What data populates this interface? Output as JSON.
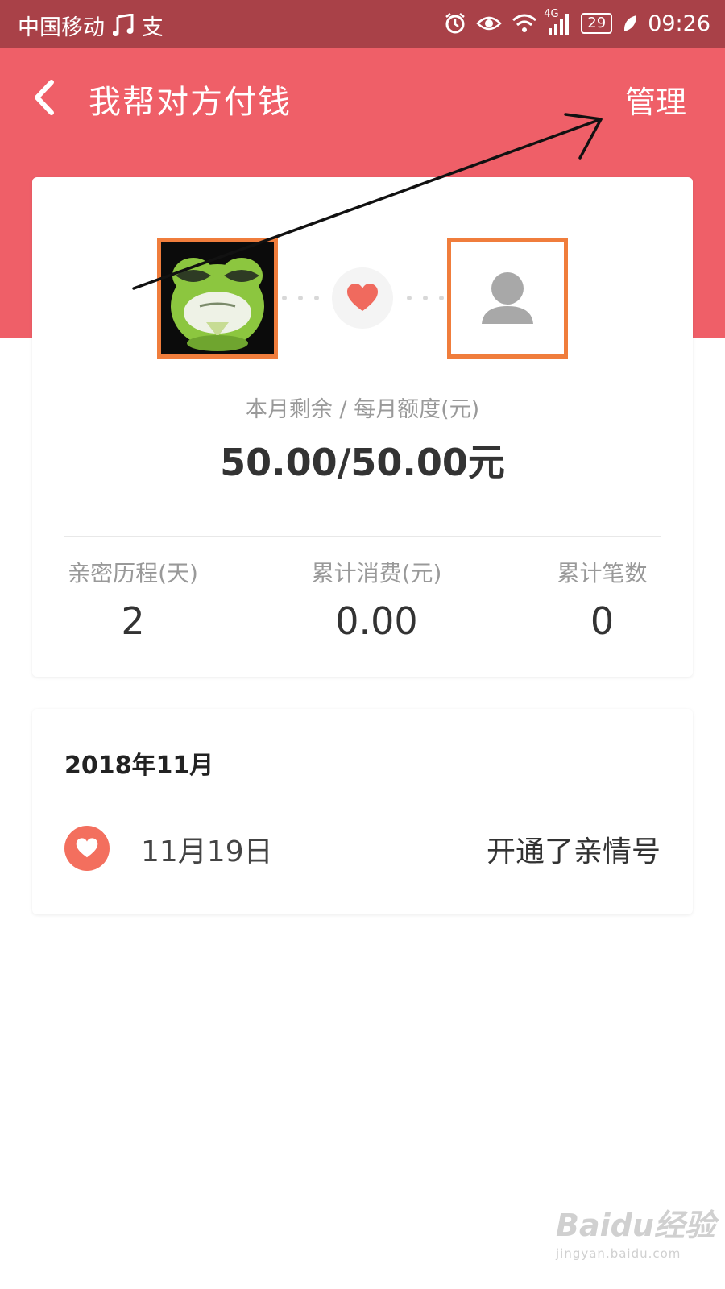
{
  "status_bar": {
    "carrier": "中国移动",
    "alipay_glyph": "支",
    "network_type": "4G",
    "battery": "29",
    "time": "09:26",
    "icons": [
      "music-icon",
      "alipay-icon",
      "alarm-icon",
      "eye-icon",
      "wifi-icon",
      "signal-icon",
      "battery-icon",
      "leaf-icon"
    ]
  },
  "header": {
    "title": "我帮对方付钱",
    "manage_label": "管理",
    "back_icon": "chevron-left-icon"
  },
  "summary": {
    "quota_label": "本月剩余 / 每月额度(元)",
    "quota_value": "50.00/50.00元",
    "stats": [
      {
        "label": "亲密历程(天)",
        "value": "2"
      },
      {
        "label": "累计消费(元)",
        "value": "0.00"
      },
      {
        "label": "累计笔数",
        "value": "0"
      }
    ]
  },
  "timeline": {
    "month": "2018年11月",
    "events": [
      {
        "date": "11月19日",
        "description": "开通了亲情号",
        "icon": "heart-icon"
      }
    ]
  },
  "watermark": {
    "main": "Baidu经验",
    "sub": "jingyan.baidu.com"
  },
  "colors": {
    "header": "#ef5f68",
    "status_bar": "#a94148",
    "avatar_border": "#f07d3c",
    "heart": "#f36f5e"
  }
}
